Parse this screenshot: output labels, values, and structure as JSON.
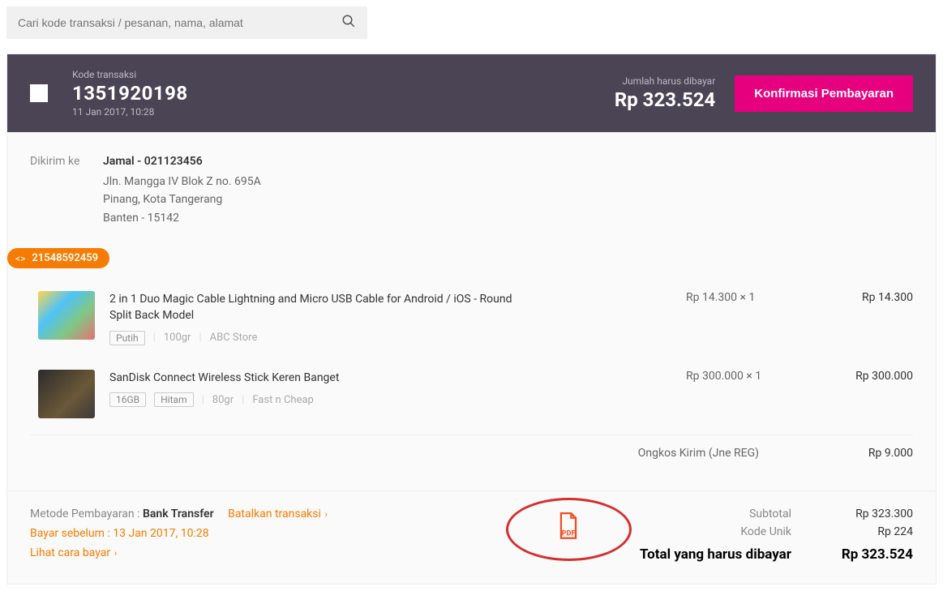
{
  "search": {
    "placeholder": "Cari kode transaksi / pesanan, nama, alamat"
  },
  "header": {
    "code_label": "Kode transaksi",
    "code": "1351920198",
    "date": "11 Jan 2017, 10:28",
    "amount_label": "Jumlah harus dibayar",
    "amount": "Rp 323.524",
    "confirm_btn": "Konfirmasi Pembayaran"
  },
  "shipping": {
    "label": "Dikirim ke",
    "name": "Jamal - 021123456",
    "line1": "Jln. Mangga IV Blok Z no. 695A",
    "line2": "Pinang, Kota Tangerang",
    "line3": "Banten - 15142"
  },
  "order_badge": "21548592459",
  "items": [
    {
      "name": "2 in 1 Duo Magic Cable Lightning and Micro USB Cable for Android / iOS - Round Split Back Model",
      "tags": [
        "Putih"
      ],
      "weight": "100gr",
      "store": "ABC Store",
      "price": "Rp 14.300 × 1",
      "total": "Rp 14.300"
    },
    {
      "name": "SanDisk Connect Wireless Stick Keren Banget",
      "tags": [
        "16GB",
        "Hitam"
      ],
      "weight": "80gr",
      "store": "Fast n Cheap",
      "price": "Rp 300.000 × 1",
      "total": "Rp 300.000"
    }
  ],
  "shipping_cost": {
    "label": "Ongkos Kirim (Jne REG)",
    "value": "Rp 9.000"
  },
  "payment": {
    "method_label": "Metode Pembayaran :",
    "method_value": "Bank Transfer",
    "cancel": "Batalkan transaksi",
    "before": "Bayar sebelum : 13 Jan 2017, 10:28",
    "how": "Lihat cara bayar"
  },
  "pdf_label": "PDF",
  "totals": {
    "subtotal_label": "Subtotal",
    "subtotal": "Rp 323.300",
    "unique_label": "Kode Unik",
    "unique": "Rp 224",
    "grand_label": "Total yang harus dibayar",
    "grand": "Rp 323.524"
  }
}
